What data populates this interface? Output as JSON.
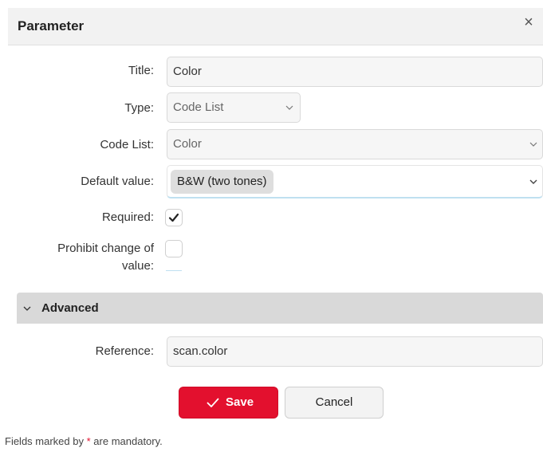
{
  "dialog": {
    "title": "Parameter",
    "close_symbol": "×"
  },
  "fields": {
    "title": {
      "label": "Title:",
      "value": "Color"
    },
    "type": {
      "label": "Type:",
      "value": "Code List"
    },
    "code_list": {
      "label": "Code List:",
      "value": "Color"
    },
    "default_value": {
      "label": "Default value:",
      "value": "B&W (two tones)"
    },
    "required": {
      "label": "Required:",
      "checked": true
    },
    "prohibit_change": {
      "label_line1": "Prohibit change of",
      "label_line2": "value:",
      "checked": false
    }
  },
  "advanced": {
    "title": "Advanced",
    "reference": {
      "label": "Reference:",
      "value": "scan.color"
    }
  },
  "buttons": {
    "save": "Save",
    "cancel": "Cancel"
  },
  "footer": {
    "prefix": "Fields marked by",
    "star": "*",
    "suffix": "are mandatory."
  },
  "colors": {
    "accent": "#e3102e",
    "header_bg": "#f2f2f2",
    "section_bg": "#d9d9d9"
  }
}
